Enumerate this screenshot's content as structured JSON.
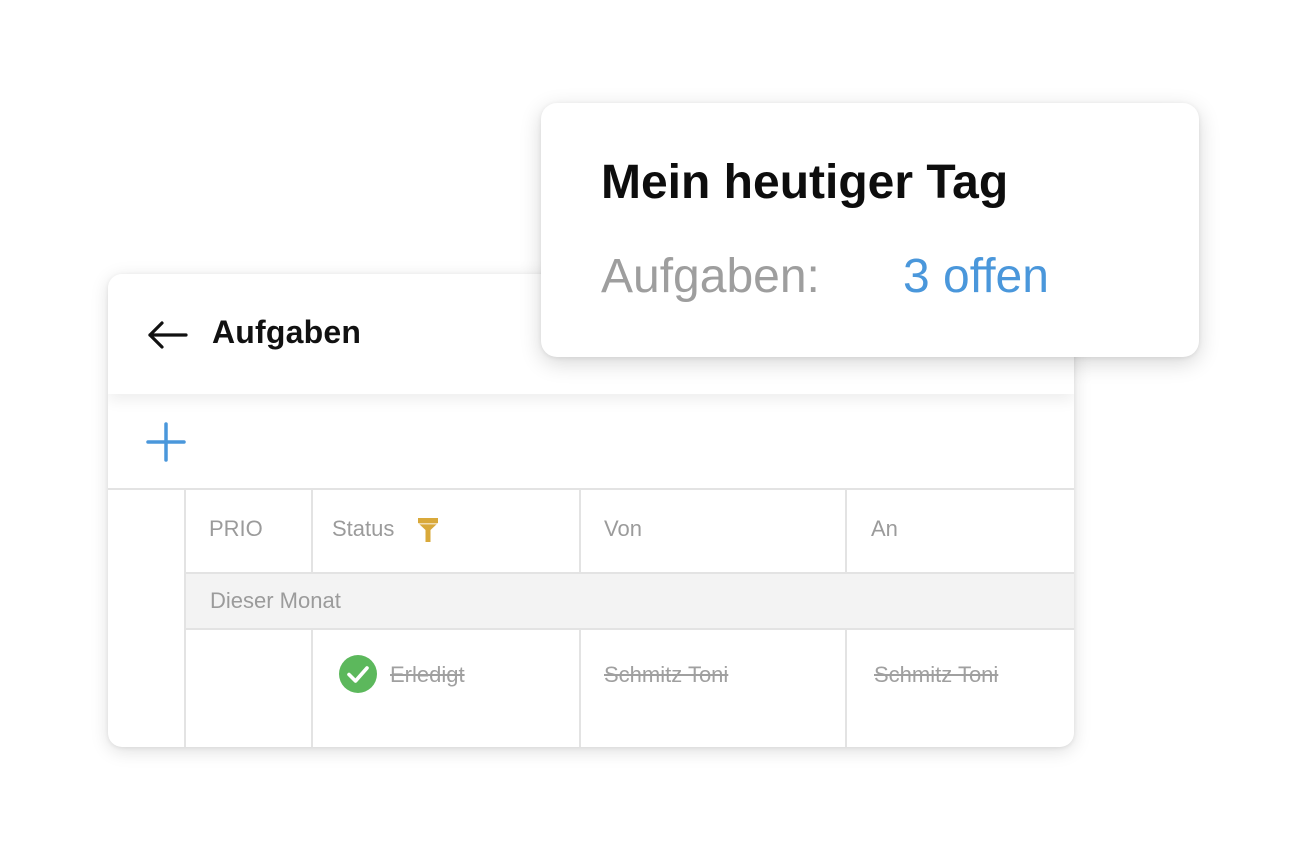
{
  "summary": {
    "title": "Mein heutiger Tag",
    "label": "Aufgaben:",
    "value": "3 offen",
    "value_color": "#4a97db"
  },
  "tasks": {
    "title": "Aufgaben",
    "back_icon": "arrow-left-icon",
    "add_icon": "plus-icon",
    "accent_color": "#4a97db",
    "table": {
      "columns": [
        "PRIO",
        "Status",
        "Von",
        "An"
      ],
      "status_filter_icon": "filter-icon",
      "filter_color": "#d9a93a",
      "group_label": "Dieser Monat",
      "rows": [
        {
          "prio": "",
          "status": "Erledigt",
          "status_icon": "check-circle-icon",
          "status_color": "#5cb85c",
          "von": "Schmitz Toni",
          "an": "Schmitz Toni",
          "strikethrough": true
        }
      ]
    }
  }
}
